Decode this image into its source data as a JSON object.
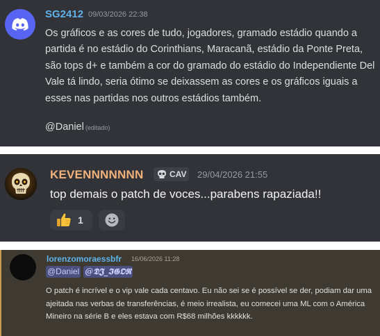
{
  "messages": [
    {
      "author": "SG2412",
      "timestamp": "09/03/2026 22:38",
      "avatar_icon": "discord-logo-icon",
      "text": "Os gráficos e as cores de tudo, jogadores, gramado estádio quando a partida é no estádio do Corinthians, Maracanã, estádio da Ponte Preta, são tops d+  e também a cor do gramado do estádio do Independiente Del Vale tá lindo, seria ótimo se deixassem as cores e os gráficos iguais a esses nas partidas nos outros estádios também.",
      "mention": "@Daniel",
      "edited_label": "(editado)"
    },
    {
      "author": "KEVENNNNNNN",
      "tag": "CAV",
      "tag_icon": "skull-icon",
      "timestamp": "29/04/2026 21:55",
      "avatar_icon": "skull-avatar",
      "text": "top demais o patch de voces...parabens rapaziada!!",
      "reaction": {
        "emoji": "thumbs-up-icon",
        "count": "1"
      },
      "add_reaction_icon": "smiley-icon"
    },
    {
      "author": "lorenzomoraessbfr",
      "timestamp": "16/06/2026 11:28",
      "mentions": [
        "@Daniel",
        "@𝕯𝕵_𝕴𝕲𝕺𝕽"
      ],
      "text": "O patch é incrível e o vip vale cada centavo. Eu não sei se é possível se der, podiam dar uma ajeitada nas verbas de transferências, é meio irrealista, eu comecei uma ML com o América Mineiro na série B e eles estava com R$68 milhões kkkkkk."
    }
  ],
  "colors": {
    "background": "#323339",
    "highlighted_background": "#3f3a31",
    "author_blue": "#5fb3e8",
    "author_orange": "#f0b27a",
    "mention_bg": "#4b4f7d",
    "blurple": "#5865f2"
  }
}
